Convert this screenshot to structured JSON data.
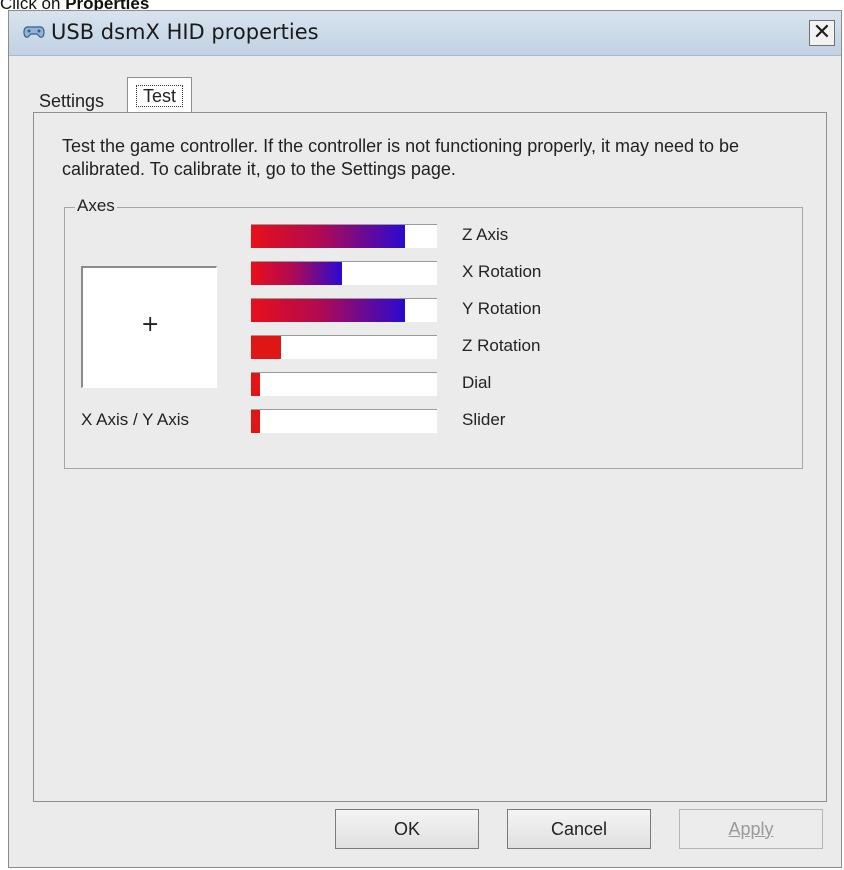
{
  "caption": {
    "prefix": "Click on ",
    "bold": "Properties"
  },
  "window": {
    "title": "USB dsmX HID properties",
    "close_label": "✕",
    "icon": "game-controller-icon"
  },
  "tabs": [
    {
      "label": "Settings",
      "selected": false
    },
    {
      "label": "Test",
      "selected": true
    }
  ],
  "test_page": {
    "instructions": "Test the game controller.  If the controller is not functioning properly, it may need to be calibrated.  To calibrate it, go to the Settings page.",
    "axes_group_label": "Axes",
    "xy_label": "X Axis / Y Axis",
    "xy_crosshair": "+",
    "bars": [
      {
        "label": "Z Axis",
        "level": 0.83
      },
      {
        "label": "X Rotation",
        "level": 0.49
      },
      {
        "label": "Y Rotation",
        "level": 0.83
      },
      {
        "label": "Z Rotation",
        "level": 0.16
      },
      {
        "label": "Dial",
        "level": 0.05
      },
      {
        "label": "Slider",
        "level": 0.05
      }
    ]
  },
  "buttons": {
    "ok": "OK",
    "cancel": "Cancel",
    "apply": "Apply"
  },
  "colors": {
    "bar_start": "#e8101a",
    "bar_end": "#2a0ad0",
    "titlebar": "#c1d2e3"
  }
}
